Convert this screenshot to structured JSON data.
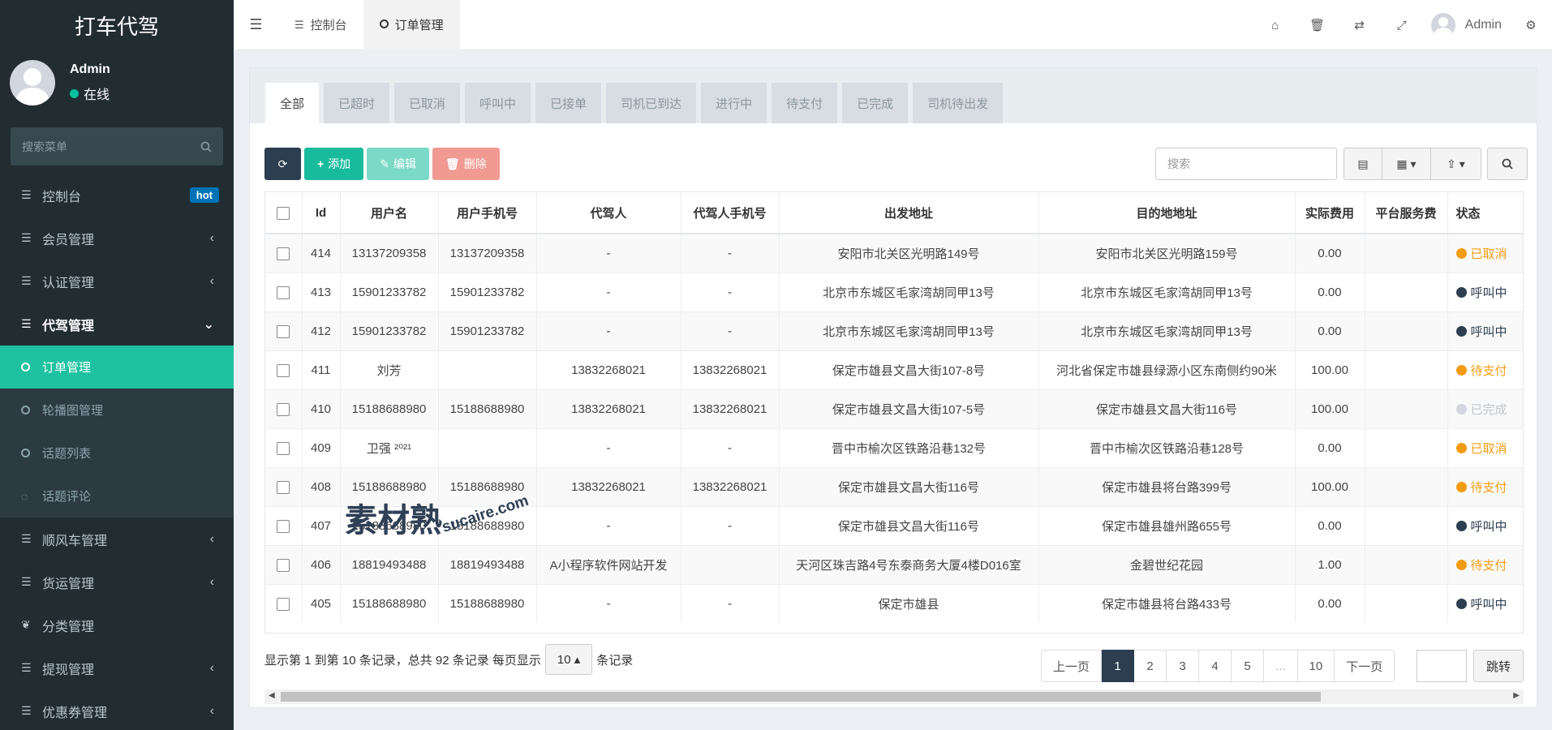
{
  "colors": {
    "sidebar_bg": "#222d32",
    "accent": "#1fc2a0",
    "pager_active": "#2c3e50",
    "hot_badge": "#0073b7"
  },
  "sidebar": {
    "brand": "打车代驾",
    "user": {
      "name": "Admin",
      "status": "在线"
    },
    "search_placeholder": "搜索菜单",
    "menu": [
      {
        "label": "控制台",
        "icon": "list-icon",
        "badge": "hot"
      },
      {
        "label": "会员管理",
        "icon": "list-icon"
      },
      {
        "label": "认证管理",
        "icon": "list-icon"
      },
      {
        "label": "代驾管理",
        "icon": "list-icon",
        "expanded": true
      }
    ],
    "submenu": [
      {
        "label": "订单管理",
        "active": true
      },
      {
        "label": "轮播图管理"
      },
      {
        "label": "话题列表"
      },
      {
        "label": "话题评论"
      }
    ],
    "menu_after": [
      {
        "label": "顺风车管理"
      },
      {
        "label": "货运管理"
      },
      {
        "label": "分类管理"
      },
      {
        "label": "提现管理"
      },
      {
        "label": "优惠券管理"
      }
    ]
  },
  "topbar": {
    "tabs": [
      {
        "label": "控制台"
      },
      {
        "label": "订单管理"
      }
    ],
    "user_name": "Admin"
  },
  "panel": {
    "tabs": [
      "全部",
      "已超时",
      "已取消",
      "呼叫中",
      "已接单",
      "司机已到达",
      "进行中",
      "待支付",
      "已完成",
      "司机待出发"
    ],
    "toolbar": {
      "add": "添加",
      "edit": "编辑",
      "delete": "删除"
    },
    "search_placeholder": "搜索"
  },
  "table": {
    "headers": [
      "Id",
      "用户名",
      "用户手机号",
      "代驾人",
      "代驾人手机号",
      "出发地址",
      "目的地地址",
      "实际费用",
      "平台服务费",
      "状态"
    ],
    "rows": [
      {
        "id": "414",
        "user": "13137209358",
        "phone": "13137209358",
        "driver": "-",
        "driver_phone": "-",
        "from": "安阳市北关区光明路149号",
        "to": "安阳市北关区光明路159号",
        "fee": "0.00",
        "service": "",
        "status": "已取消",
        "status_color": "#f39c12"
      },
      {
        "id": "413",
        "user": "15901233782",
        "phone": "15901233782",
        "driver": "-",
        "driver_phone": "-",
        "from": "北京市东城区毛家湾胡同甲13号",
        "to": "北京市东城区毛家湾胡同甲13号",
        "fee": "0.00",
        "service": "",
        "status": "呼叫中",
        "status_color": "#2c3e50"
      },
      {
        "id": "412",
        "user": "15901233782",
        "phone": "15901233782",
        "driver": "-",
        "driver_phone": "-",
        "from": "北京市东城区毛家湾胡同甲13号",
        "to": "北京市东城区毛家湾胡同甲13号",
        "fee": "0.00",
        "service": "",
        "status": "呼叫中",
        "status_color": "#2c3e50"
      },
      {
        "id": "411",
        "user": "刘芳",
        "phone": "",
        "driver": "13832268021",
        "driver_phone": "13832268021",
        "from": "保定市雄县文昌大街107-8号",
        "to": "河北省保定市雄县绿源小区东南侧约90米",
        "fee": "100.00",
        "service": "",
        "status": "待支付",
        "status_color": "#f39c12"
      },
      {
        "id": "410",
        "user": "15188688980",
        "phone": "15188688980",
        "driver": "13832268021",
        "driver_phone": "13832268021",
        "from": "保定市雄县文昌大街107-5号",
        "to": "保定市雄县文昌大街116号",
        "fee": "100.00",
        "service": "",
        "status": "已完成",
        "status_color": "#d2d6de"
      },
      {
        "id": "409",
        "user": "卫强 ²⁰²¹",
        "phone": "",
        "driver": "-",
        "driver_phone": "-",
        "from": "晋中市榆次区铁路沿巷132号",
        "to": "晋中市榆次区铁路沿巷128号",
        "fee": "0.00",
        "service": "",
        "status": "已取消",
        "status_color": "#f39c12"
      },
      {
        "id": "408",
        "user": "15188688980",
        "phone": "15188688980",
        "driver": "13832268021",
        "driver_phone": "13832268021",
        "from": "保定市雄县文昌大街116号",
        "to": "保定市雄县将台路399号",
        "fee": "100.00",
        "service": "",
        "status": "待支付",
        "status_color": "#f39c12"
      },
      {
        "id": "407",
        "user": "15188688980",
        "phone": "15188688980",
        "driver": "-",
        "driver_phone": "-",
        "from": "保定市雄县文昌大街116号",
        "to": "保定市雄县雄州路655号",
        "fee": "0.00",
        "service": "",
        "status": "呼叫中",
        "status_color": "#2c3e50"
      },
      {
        "id": "406",
        "user": "18819493488",
        "phone": "18819493488",
        "driver": "A小程序软件网站开发",
        "driver_phone": "",
        "from": "天河区珠吉路4号东泰商务大厦4楼D016室",
        "to": "金碧世纪花园",
        "fee": "1.00",
        "service": "",
        "status": "待支付",
        "status_color": "#f39c12"
      },
      {
        "id": "405",
        "user": "15188688980",
        "phone": "15188688980",
        "driver": "-",
        "driver_phone": "-",
        "from": "保定市雄县",
        "to": "保定市雄县将台路433号",
        "fee": "0.00",
        "service": "",
        "status": "呼叫中",
        "status_color": "#2c3e50"
      }
    ]
  },
  "footer": {
    "info_prefix": "显示第 1 到第 10 条记录，总共 92 条记录 每页显示",
    "page_size": "10",
    "info_suffix": "条记录",
    "prev": "上一页",
    "pages": [
      "1",
      "2",
      "3",
      "4",
      "5",
      "...",
      "10"
    ],
    "next": "下一页",
    "jump": "跳转"
  },
  "watermark": {
    "main": "素材熟",
    "sub": "sucaire.com"
  }
}
